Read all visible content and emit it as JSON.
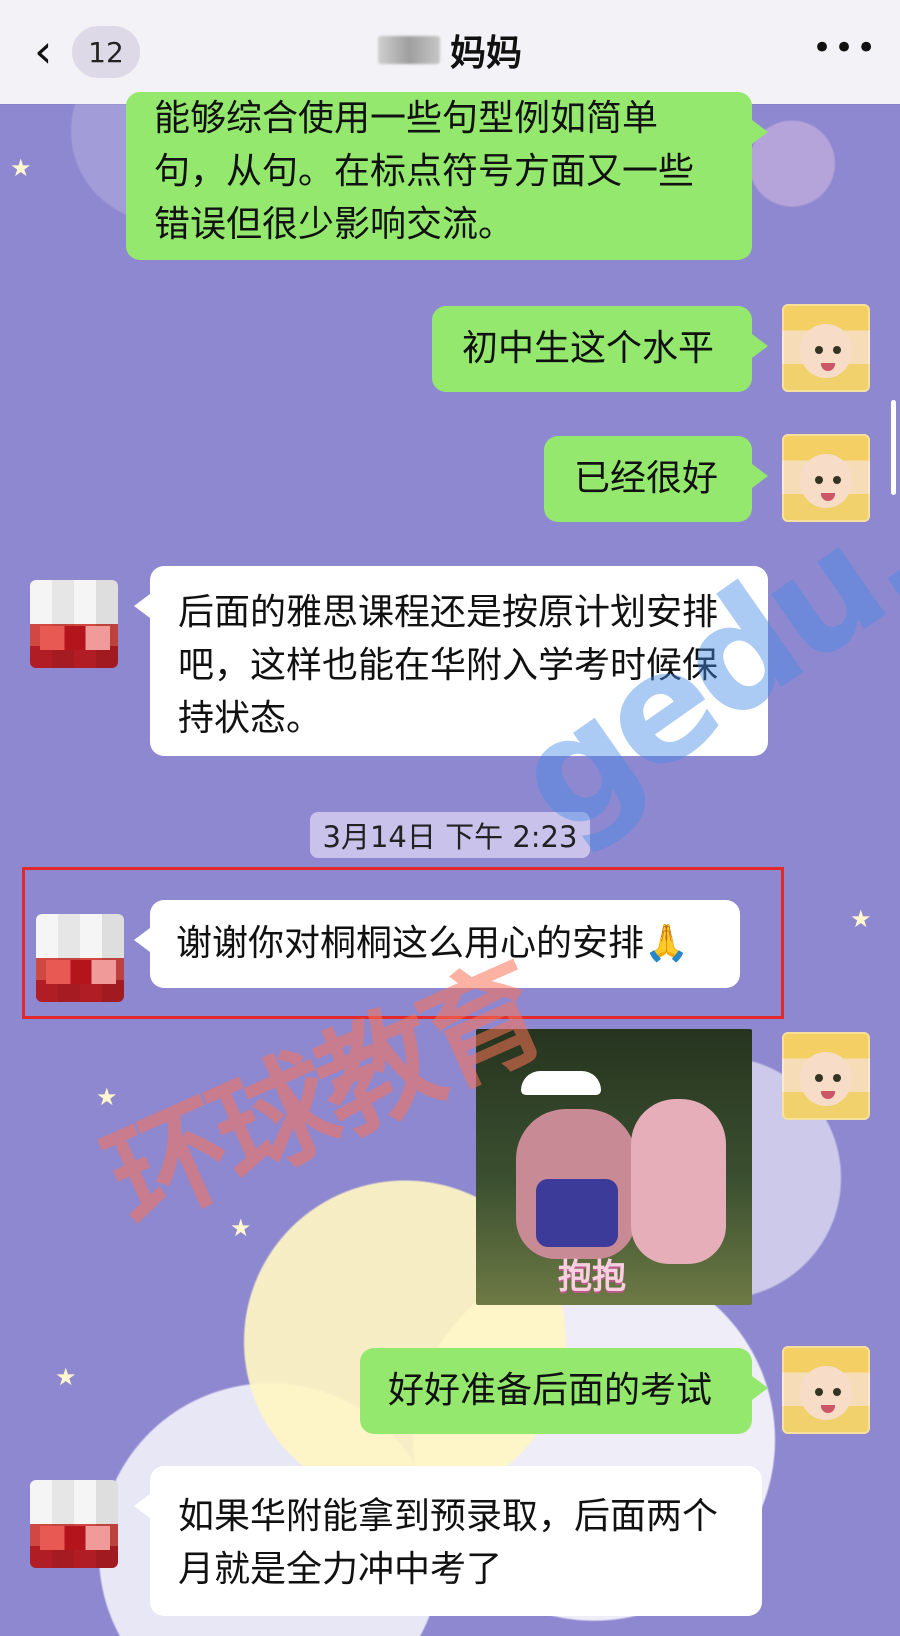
{
  "header": {
    "unread_count": "12",
    "title": "妈妈",
    "back_icon": "chevron-left-icon",
    "more_icon": "more-icon"
  },
  "messages": [
    {
      "side": "left",
      "text": "能够综合使用一些句型例如简单句，从句。在标点符号方面又一些错误但很少影响交流。"
    },
    {
      "side": "right",
      "text": "初中生这个水平"
    },
    {
      "side": "right",
      "text": "已经很好"
    },
    {
      "side": "left",
      "text": "后面的雅思课程还是按原计划安排吧，这样也能在华附入学考时候保持状态。"
    },
    {
      "side": "left",
      "text": "谢谢你对桐桐这么用心的安排🙏"
    },
    {
      "side": "right",
      "text": "好好准备后面的考试"
    },
    {
      "side": "left",
      "text": "如果华附能拿到预录取，后面两个月就是全力冲中考了"
    }
  ],
  "timestamp": "3月14日 下午 2:23",
  "sticker": {
    "text": "抱抱"
  },
  "watermark": {
    "left_text": "环球教育",
    "site": "gedu.org"
  },
  "colors": {
    "green_bubble": "#95e86e",
    "white_bubble": "#ffffff",
    "highlight": "#e22a2a"
  }
}
